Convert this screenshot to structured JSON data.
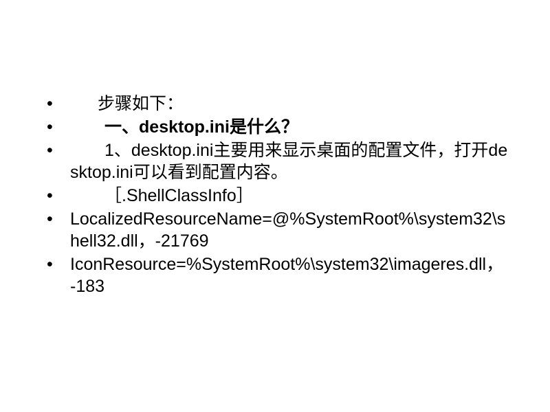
{
  "slide": {
    "items": [
      {
        "prefix_indent": "indent1",
        "prefix": "",
        "text": "步骤如下：",
        "bold": false
      },
      {
        "prefix_indent": "indent2",
        "prefix": "一、",
        "text": "desktop.ini是什么？",
        "bold": true
      },
      {
        "prefix_indent": "indent2",
        "prefix": "1、",
        "text": "desktop.ini主要用来显示桌面的配置文件，打开desktop.ini可以看到配置内容。",
        "bold": false
      },
      {
        "prefix_indent": "indent2",
        "prefix": "",
        "text": "［.ShellClassInfo］",
        "bold": false
      },
      {
        "prefix_indent": "",
        "prefix": "",
        "text": "LocalizedResourceName=@%SystemRoot%\\system32\\shell32.dll，-21769",
        "bold": false
      },
      {
        "prefix_indent": "",
        "prefix": "",
        "text": "IconResource=%SystemRoot%\\system32\\imageres.dll，-183",
        "bold": false
      }
    ]
  }
}
